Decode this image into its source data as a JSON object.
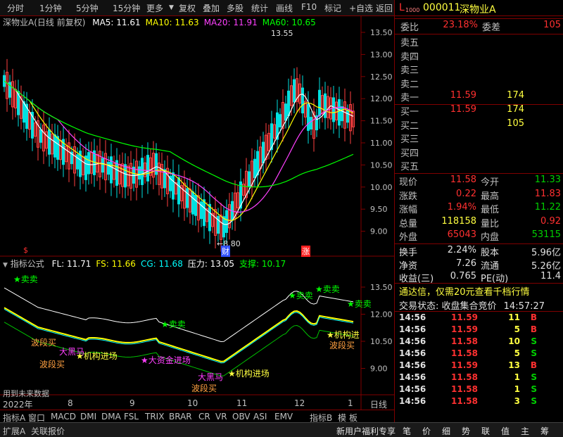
{
  "toolbar": {
    "left": [
      "分时",
      "1分钟",
      "5分钟",
      "15分钟",
      "更多"
    ],
    "right": [
      "复权",
      "叠加",
      "多股",
      "统计",
      "画线",
      "F10",
      "标记",
      "+自选",
      "返回"
    ]
  },
  "main_header": {
    "name": "深物业A(日线 前复权)",
    "ma": [
      {
        "label": "MA5: 11.61",
        "color": "#ffffff"
      },
      {
        "label": "MA10: 11.63",
        "color": "#ffff00"
      },
      {
        "label": "MA20: 11.91",
        "color": "#ff40ff"
      },
      {
        "label": "MA60: 10.65",
        "color": "#00ff00"
      }
    ]
  },
  "price_axis": [
    "13.50",
    "13.00",
    "12.50",
    "12.00",
    "11.50",
    "11.00",
    "10.50",
    "10.00",
    "9.50",
    "9.00"
  ],
  "price_annotations": {
    "high": "13.55",
    "low": "8.80"
  },
  "markers": {
    "s": "$",
    "cai": "财",
    "zhang": "涨"
  },
  "indicator_header": {
    "name": "指标公式",
    "values": [
      {
        "label": "FL: 11.71",
        "color": "#ffffff"
      },
      {
        "label": "FS: 11.66",
        "color": "#ffff00"
      },
      {
        "label": "CG: 11.68",
        "color": "#00ffff"
      },
      {
        "label": "压力: 13.05",
        "color": "#ffffff"
      },
      {
        "label": "支撑: 10.17",
        "color": "#00ff00"
      }
    ]
  },
  "indicator_axis": [
    "13.50",
    "12.00",
    "10.50",
    "9.00"
  ],
  "indicator_labels": {
    "sell": "卖卖",
    "wave_buy": "波段买",
    "big_horse": "大黑马",
    "inst_entry": "机构进场",
    "big_fund": "大资金进场",
    "inst_short": "机构进",
    "future": "用到未来数据"
  },
  "date_axis": {
    "year": "2022年",
    "months": [
      "8",
      "9",
      "10",
      "11",
      "12",
      "1"
    ],
    "period": "日线"
  },
  "tabs": [
    "指标A",
    "窗口",
    "MACD",
    "DMI",
    "DMA",
    "FSL",
    "TRIX",
    "BRAR",
    "CR",
    "VR",
    "OBV",
    "ASI",
    "EMV",
    "指标B",
    "模",
    "板"
  ],
  "bottom": {
    "left": [
      "扩展A",
      "关联报价"
    ],
    "promo": "新用户福利专享",
    "right": [
      "笔",
      "价",
      "细",
      "势",
      "联",
      "值",
      "主",
      "筹"
    ]
  },
  "stock": {
    "code_prefix": "L",
    "code_sub": "1000",
    "code": "000011",
    "name": "深物业A"
  },
  "committee": {
    "ratio_label": "委比",
    "ratio": "23.18%",
    "diff_label": "委差",
    "diff": "105"
  },
  "asks": [
    {
      "label": "卖五",
      "price": "",
      "vol": ""
    },
    {
      "label": "卖四",
      "price": "",
      "vol": ""
    },
    {
      "label": "卖三",
      "price": "",
      "vol": ""
    },
    {
      "label": "卖二",
      "price": "",
      "vol": ""
    },
    {
      "label": "卖一",
      "price": "11.59",
      "vol": "174"
    }
  ],
  "bids": [
    {
      "label": "买一",
      "price": "11.59",
      "vol": "174"
    },
    {
      "label": "买二",
      "price": "",
      "vol": "105"
    },
    {
      "label": "买三",
      "price": "",
      "vol": ""
    },
    {
      "label": "买四",
      "price": "",
      "vol": ""
    },
    {
      "label": "买五",
      "price": "",
      "vol": ""
    }
  ],
  "quote": [
    {
      "l1": "现价",
      "v1": "11.58",
      "c1": "#ff3030",
      "l2": "今开",
      "v2": "11.33",
      "c2": "#00d000"
    },
    {
      "l1": "涨跌",
      "v1": "0.22",
      "c1": "#ff3030",
      "l2": "最高",
      "v2": "11.83",
      "c2": "#ff3030"
    },
    {
      "l1": "涨幅",
      "v1": "1.94%",
      "c1": "#ff3030",
      "l2": "最低",
      "v2": "11.22",
      "c2": "#00d000"
    },
    {
      "l1": "总量",
      "v1": "118158",
      "c1": "#ffff40",
      "l2": "量比",
      "v2": "0.92",
      "c2": "#ff3030"
    },
    {
      "l1": "外盘",
      "v1": "65043",
      "c1": "#ff3030",
      "l2": "内盘",
      "v2": "53115",
      "c2": "#00d000"
    }
  ],
  "quote2": [
    {
      "l1": "换手",
      "v1": "2.24%",
      "l2": "股本",
      "v2": "5.96亿"
    },
    {
      "l1": "净资",
      "v1": "7.26",
      "l2": "流通",
      "v2": "5.26亿"
    },
    {
      "l1": "收益(三)",
      "v1": "0.765",
      "l2": "PE(动)",
      "v2": "11.4"
    }
  ],
  "ad": "通达信，仅需20元查看千档行情",
  "trade_status": {
    "label": "交易状态: 收盘集合竞价",
    "time": "14:57:27"
  },
  "ticks": [
    {
      "t": "14:56",
      "p": "11.59",
      "v": "11",
      "d": "B"
    },
    {
      "t": "14:56",
      "p": "11.59",
      "v": "5",
      "d": "B"
    },
    {
      "t": "14:56",
      "p": "11.58",
      "v": "10",
      "d": "S"
    },
    {
      "t": "14:56",
      "p": "11.58",
      "v": "5",
      "d": "S"
    },
    {
      "t": "14:56",
      "p": "11.59",
      "v": "13",
      "d": "B"
    },
    {
      "t": "14:56",
      "p": "11.58",
      "v": "1",
      "d": "S"
    },
    {
      "t": "14:56",
      "p": "11.58",
      "v": "1",
      "d": "S"
    },
    {
      "t": "14:56",
      "p": "11.58",
      "v": "3",
      "d": "S"
    }
  ]
}
